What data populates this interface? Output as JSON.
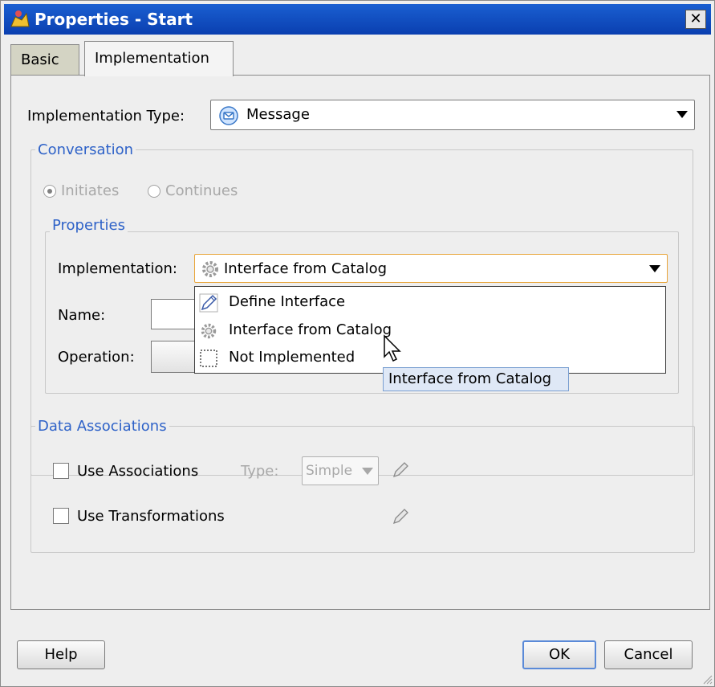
{
  "window": {
    "title": "Properties - Start",
    "close_glyph": "✕"
  },
  "tabs": [
    {
      "label": "Basic",
      "active": false
    },
    {
      "label": "Implementation",
      "active": true
    }
  ],
  "implementation_type": {
    "label": "Implementation Type:",
    "value": "Message",
    "icon": "message-icon"
  },
  "conversation": {
    "legend": "Conversation",
    "radios": [
      {
        "label": "Initiates",
        "checked": true,
        "enabled": false
      },
      {
        "label": "Continues",
        "checked": false,
        "enabled": false
      }
    ],
    "properties": {
      "legend": "Properties",
      "implementation_label": "Implementation:",
      "implementation_value": "Interface from Catalog",
      "name_label": "Name:",
      "operation_label": "Operation:"
    }
  },
  "implementation_menu": {
    "items": [
      {
        "label": "Define Interface",
        "icon": "pencil-icon"
      },
      {
        "label": "Interface from Catalog",
        "icon": "gear-icon"
      },
      {
        "label": "Not Implemented",
        "icon": "dashed-box-icon"
      }
    ]
  },
  "tooltip": "Interface from Catalog",
  "data_associations": {
    "legend": "Data Associations",
    "use_associations_label": "Use Associations",
    "type_label": "Type:",
    "type_value": "Simple",
    "use_transformations_label": "Use Transformations"
  },
  "buttons": {
    "help": "Help",
    "ok": "OK",
    "cancel": "Cancel"
  },
  "colors": {
    "title_bar": "#0a3fb0",
    "legend_text": "#2e62c8",
    "tooltip_bg": "#dfe8f6"
  }
}
